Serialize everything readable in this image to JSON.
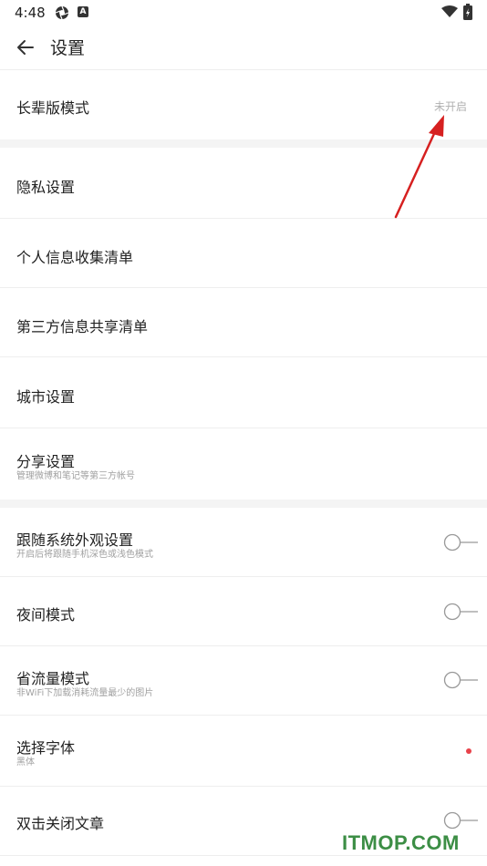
{
  "status": {
    "time": "4:48"
  },
  "header": {
    "title": "设置"
  },
  "rows": [
    {
      "label": "长辈版模式",
      "value": "未开启"
    },
    {
      "label": "隐私设置"
    },
    {
      "label": "个人信息收集清单"
    },
    {
      "label": "第三方信息共享清单"
    },
    {
      "label": "城市设置"
    },
    {
      "label": "分享设置",
      "sub": "管理微博和笔记等第三方帐号"
    },
    {
      "label": "跟随系统外观设置",
      "sub": "开启后将跟随手机深色或浅色模式",
      "toggle": false
    },
    {
      "label": "夜间模式",
      "toggle": false
    },
    {
      "label": "省流量模式",
      "sub": "非WiFi下加载消耗流量最少的图片",
      "toggle": false
    },
    {
      "label": "选择字体",
      "sub": "黑体"
    },
    {
      "label": "双击关闭文章",
      "toggle": false
    }
  ],
  "watermark": "ITMOP.COM",
  "colors": {
    "accent_dot": "#e8424a",
    "annotation_arrow": "#d62020",
    "watermark": "#3c8e45"
  }
}
